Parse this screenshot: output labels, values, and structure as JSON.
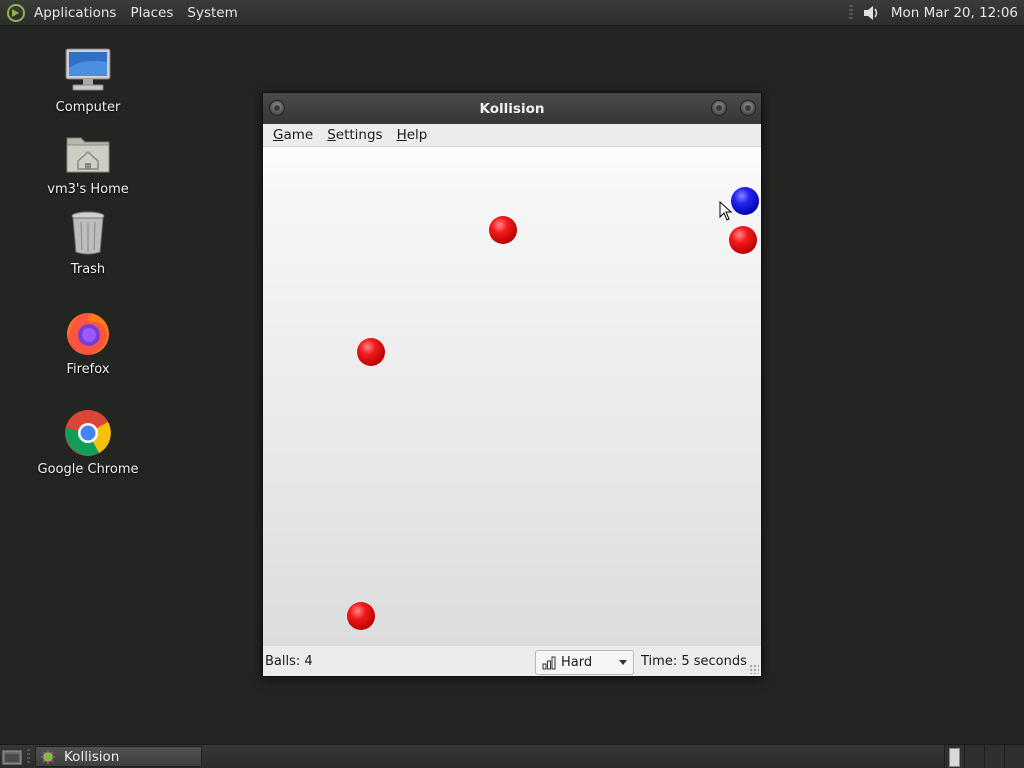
{
  "top_panel": {
    "menus": [
      "Applications",
      "Places",
      "System"
    ],
    "clock": "Mon Mar 20, 12:06"
  },
  "desktop_icons": [
    {
      "label": "Computer",
      "icon": "computer-icon"
    },
    {
      "label": "vm3's Home",
      "icon": "home-folder-icon"
    },
    {
      "label": "Trash",
      "icon": "trash-icon"
    },
    {
      "label": "Firefox",
      "icon": "firefox-icon"
    },
    {
      "label": "Google Chrome",
      "icon": "chrome-icon"
    }
  ],
  "window": {
    "title": "Kollision",
    "menu": {
      "game": {
        "accel": "G",
        "rest": "ame"
      },
      "settings": {
        "accel": "S",
        "rest": "ettings"
      },
      "help": {
        "accel": "H",
        "rest": "elp"
      }
    },
    "status": {
      "balls": "Balls: 4",
      "difficulty": "Hard",
      "time": "Time: 5 seconds"
    }
  },
  "taskbar": {
    "task_label": "Kollision"
  },
  "colors": {
    "panel_bg": "#2c2e2c",
    "desktop_bg": "#232523",
    "ball_red": "#e00000",
    "ball_blue": "#1010e0"
  }
}
